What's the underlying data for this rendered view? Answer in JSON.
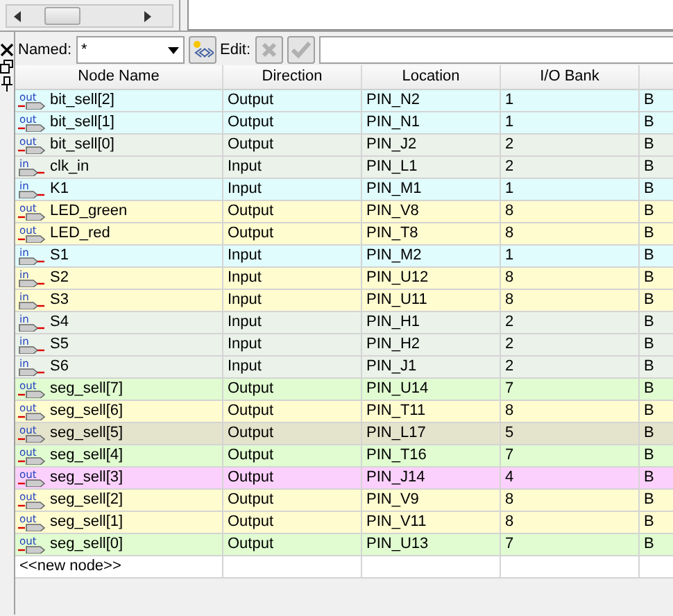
{
  "toolbar": {
    "named_label": "Named:",
    "named_value": "*",
    "edit_label": "Edit:"
  },
  "table": {
    "columns": [
      "Node Name",
      "Direction",
      "Location",
      "I/O Bank"
    ],
    "rows": [
      {
        "kind": "out",
        "cells": [
          "bit_sell[2]",
          "Output",
          "PIN_N2",
          "1",
          "B"
        ],
        "color": "#e0fcfc"
      },
      {
        "kind": "out",
        "cells": [
          "bit_sell[1]",
          "Output",
          "PIN_N1",
          "1",
          "B"
        ],
        "color": "#e0fcfc"
      },
      {
        "kind": "out",
        "cells": [
          "bit_sell[0]",
          "Output",
          "PIN_J2",
          "2",
          "B"
        ],
        "color": "#eaf2ea"
      },
      {
        "kind": "in",
        "cells": [
          "clk_in",
          "Input",
          "PIN_L1",
          "2",
          "B"
        ],
        "color": "#eaf2ea"
      },
      {
        "kind": "in",
        "cells": [
          "K1",
          "Input",
          "PIN_M1",
          "1",
          "B"
        ],
        "color": "#e0fcfc"
      },
      {
        "kind": "out",
        "cells": [
          "LED_green",
          "Output",
          "PIN_V8",
          "8",
          "B"
        ],
        "color": "#fffcd0"
      },
      {
        "kind": "out",
        "cells": [
          "LED_red",
          "Output",
          "PIN_T8",
          "8",
          "B"
        ],
        "color": "#fffcd0"
      },
      {
        "kind": "in",
        "cells": [
          "S1",
          "Input",
          "PIN_M2",
          "1",
          "B"
        ],
        "color": "#e0fcfc"
      },
      {
        "kind": "in",
        "cells": [
          "S2",
          "Input",
          "PIN_U12",
          "8",
          "B"
        ],
        "color": "#fffcd0"
      },
      {
        "kind": "in",
        "cells": [
          "S3",
          "Input",
          "PIN_U11",
          "8",
          "B"
        ],
        "color": "#fffcd0"
      },
      {
        "kind": "in",
        "cells": [
          "S4",
          "Input",
          "PIN_H1",
          "2",
          "B"
        ],
        "color": "#eaf2ea"
      },
      {
        "kind": "in",
        "cells": [
          "S5",
          "Input",
          "PIN_H2",
          "2",
          "B"
        ],
        "color": "#eaf2ea"
      },
      {
        "kind": "in",
        "cells": [
          "S6",
          "Input",
          "PIN_J1",
          "2",
          "B"
        ],
        "color": "#eaf2ea"
      },
      {
        "kind": "out",
        "cells": [
          "seg_sell[7]",
          "Output",
          "PIN_U14",
          "7",
          "B"
        ],
        "color": "#e0fcd0"
      },
      {
        "kind": "out",
        "cells": [
          "seg_sell[6]",
          "Output",
          "PIN_T11",
          "8",
          "B"
        ],
        "color": "#fffcd0"
      },
      {
        "kind": "out",
        "cells": [
          "seg_sell[5]",
          "Output",
          "PIN_L17",
          "5",
          "B"
        ],
        "color": "#e4e4cc"
      },
      {
        "kind": "out",
        "cells": [
          "seg_sell[4]",
          "Output",
          "PIN_T16",
          "7",
          "B"
        ],
        "color": "#e0fcd0"
      },
      {
        "kind": "out",
        "cells": [
          "seg_sell[3]",
          "Output",
          "PIN_J14",
          "4",
          "B"
        ],
        "color": "#fcd0fc"
      },
      {
        "kind": "out",
        "cells": [
          "seg_sell[2]",
          "Output",
          "PIN_V9",
          "8",
          "B"
        ],
        "color": "#fffcd0"
      },
      {
        "kind": "out",
        "cells": [
          "seg_sell[1]",
          "Output",
          "PIN_V11",
          "8",
          "B"
        ],
        "color": "#fffcd0"
      },
      {
        "kind": "out",
        "cells": [
          "seg_sell[0]",
          "Output",
          "PIN_U13",
          "7",
          "B"
        ],
        "color": "#e0fcd0"
      }
    ],
    "new_row": "<<new node>>"
  }
}
